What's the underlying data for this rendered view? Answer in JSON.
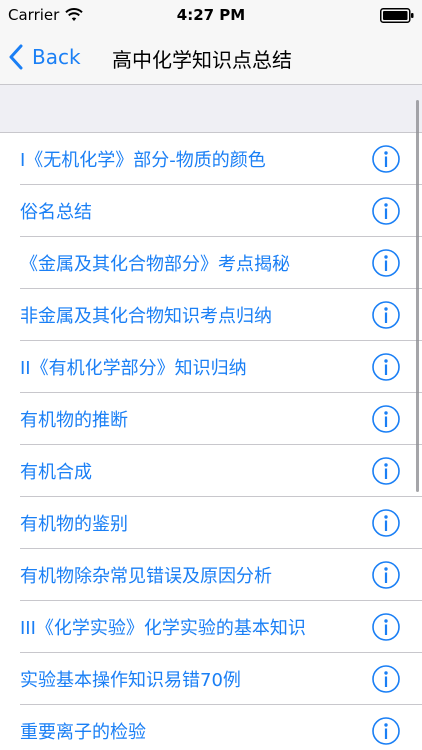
{
  "status_bar": {
    "carrier": "Carrier",
    "time": "4:27 PM",
    "icons": [
      "wifi-icon",
      "battery-icon"
    ]
  },
  "nav": {
    "back_label": "Back",
    "title": "高中化学知识点总结",
    "back_icon": "chevron-left-icon"
  },
  "colors": {
    "accent": "#1a7ff5",
    "bar_bg": "#f7f7f7",
    "section_bg": "#efeff4",
    "separator": "#c8c7cc"
  },
  "list": {
    "accessory_icon": "info-icon",
    "items": [
      {
        "label": "I《无机化学》部分-物质的颜色"
      },
      {
        "label": "俗名总结"
      },
      {
        "label": "《金属及其化合物部分》考点揭秘"
      },
      {
        "label": "非金属及其化合物知识考点归纳"
      },
      {
        "label": "II《有机化学部分》知识归纳"
      },
      {
        "label": "有机物的推断"
      },
      {
        "label": "有机合成"
      },
      {
        "label": "有机物的鉴别"
      },
      {
        "label": "有机物除杂常见错误及原因分析"
      },
      {
        "label": "III《化学实验》化学实验的基本知识"
      },
      {
        "label": "实验基本操作知识易错70例"
      },
      {
        "label": "重要离子的检验"
      }
    ]
  }
}
